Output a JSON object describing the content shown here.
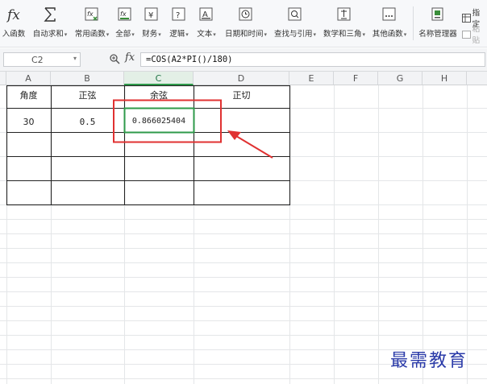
{
  "ribbon": {
    "buttons": [
      {
        "label": "入函数",
        "icon": "fx-icon"
      },
      {
        "label": "自动求和",
        "icon": "sigma-icon",
        "caret": "▾"
      },
      {
        "label": "常用函数",
        "icon": "function-star-icon",
        "caret": "▾"
      },
      {
        "label": "全部",
        "icon": "function-all-icon",
        "caret": "▾"
      },
      {
        "label": "财务",
        "icon": "yen-icon",
        "caret": "▾"
      },
      {
        "label": "逻辑",
        "icon": "logic-icon",
        "caret": "▾"
      },
      {
        "label": "文本",
        "icon": "text-icon",
        "caret": "▾"
      },
      {
        "label": "日期和时间",
        "icon": "clock-icon",
        "caret": "▾"
      },
      {
        "label": "查找与引用",
        "icon": "lookup-icon",
        "caret": "▾"
      },
      {
        "label": "数学和三角",
        "icon": "math-icon",
        "caret": "▾"
      },
      {
        "label": "其他函数",
        "icon": "more-functions-icon",
        "caret": "▾"
      },
      {
        "label": "名称管理器",
        "icon": "name-manager-icon"
      }
    ],
    "side_labels": [
      "指定",
      "粘贴"
    ]
  },
  "formula_bar": {
    "name_box": "C2",
    "fx": "fx",
    "formula": "=COS(A2*PI()/180)"
  },
  "sheet": {
    "columns": [
      "A",
      "B",
      "C",
      "D",
      "E",
      "F",
      "G",
      "H"
    ],
    "active_column": "C",
    "headers": [
      "角度",
      "正弦",
      "余弦",
      "正切"
    ],
    "row2": [
      "30",
      "0.5",
      "0.866025404",
      ""
    ]
  },
  "annotation": {
    "highlight_color": "#e03131",
    "selection_color": "#2e9a4a"
  },
  "watermark": "最需教育"
}
